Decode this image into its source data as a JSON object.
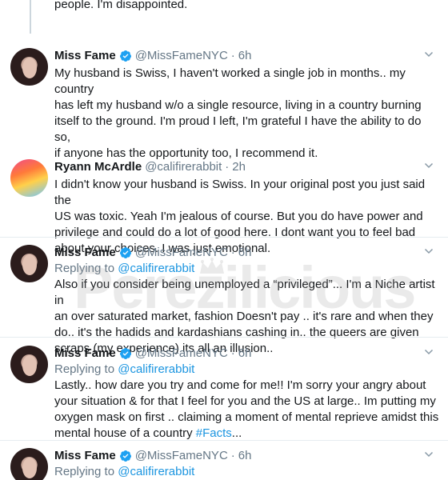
{
  "fragment": {
    "text": "people. I'm disappointed."
  },
  "tweets": [
    {
      "name": "Miss Fame",
      "handle": "@MissFameNYC",
      "separator": "·",
      "time": "6h",
      "verified": true,
      "lines": [
        "My husband is Swiss, I haven't worked a single job in months.. my country",
        "has left my husband w/o a single resource, living in a country burning",
        "itself to the ground. I'm proud I left, I'm grateful I have the ability to do so,",
        "if anyone has the opportunity too, I recommend it."
      ]
    },
    {
      "name": "Ryann McArdle",
      "handle": "@califirerabbit",
      "separator": "·",
      "time": "2h",
      "verified": false,
      "lines": [
        "I didn't know your husband is Swiss. In your original post you just said the",
        "US was toxic. Yeah I'm jealous of course. But you do have power and",
        "privilege and could do a lot of good here. I dont want you to feel bad",
        "about your choices. I was just emotional."
      ]
    },
    {
      "name": "Miss Fame",
      "handle": "@MissFameNYC",
      "separator": "·",
      "time": "6h",
      "verified": true,
      "replying_prefix": "Replying to ",
      "replying_to": "@califirerabbit",
      "lines": [
        "Also if you consider being unemployed a “privileged”... I'm a Niche artist in",
        "an over saturated market, fashion Doesn't pay .. it's rare and when they",
        "do.. it's the hadids and kardashians cashing in.. the queers are given",
        "scraps (my experience) its all an illusion.."
      ]
    },
    {
      "name": "Miss Fame",
      "handle": "@MissFameNYC",
      "separator": "·",
      "time": "6h",
      "verified": true,
      "replying_prefix": "Replying to ",
      "replying_to": "@califirerabbit",
      "lines": [
        "Lastly.. how dare you try and come for me!! I'm sorry your angry about",
        "your situation & for that I feel for you and the US at large.. Im putting my",
        "oxygen mask on first .. claiming a moment of mental reprieve amidst this",
        "mental house of a country "
      ],
      "hashtag": "#Facts",
      "hashtag_suffix": "..."
    },
    {
      "name": "Miss Fame",
      "handle": "@MissFameNYC",
      "separator": "·",
      "time": "6h",
      "verified": true,
      "replying_prefix": "Replying to ",
      "replying_to": "@califirerabbit",
      "lines": []
    }
  ],
  "watermark": {
    "text": "Perezilicious"
  },
  "colors": {
    "link": "#1b95e0",
    "muted": "#657786",
    "text": "#14171a",
    "divider": "#e6ecf0",
    "verified": "#1da1f2"
  },
  "icons": {
    "verified": "verified-badge-icon",
    "caret": "chevron-down-icon"
  }
}
